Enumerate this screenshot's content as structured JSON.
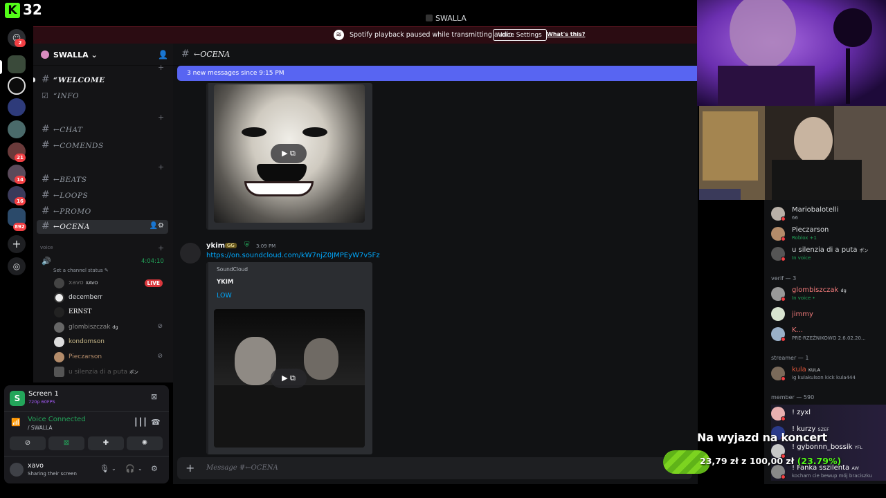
{
  "stream": {
    "viewer_count": "32"
  },
  "window": {
    "title": "SWALLA"
  },
  "notice": {
    "text": "Spotify playback paused while transmitting audio.",
    "button": "Voice Settings",
    "link": "What's this?"
  },
  "rail": {
    "badges": [
      "2",
      "21",
      "14",
      "16",
      "892"
    ]
  },
  "guild": {
    "name": "SWALLA",
    "channels": [
      "“WELCOME",
      "“INFO",
      "←CHAT",
      "←COMENDS",
      "←BEATS",
      "←LOOPS",
      "←PROMO",
      "←OCENA"
    ],
    "voice_category": "voice",
    "voice_timer": "4:04:10",
    "voice_status": "Set a channel status",
    "live_badge": "LIVE",
    "voice_users": [
      {
        "name": "xavo",
        "tag": "XAVO",
        "color": "#6b6b6b"
      },
      {
        "name": "decemberr",
        "tag": "",
        "color": "#dbdee1"
      },
      {
        "name": "ERNST",
        "tag": "",
        "color": "#ffffff"
      },
      {
        "name": "glombiszczak",
        "tag": "dg",
        "color": "#8a8a8a"
      },
      {
        "name": "kondomson",
        "tag": "",
        "color": "#c9b98a"
      },
      {
        "name": "Pieczarson",
        "tag": "",
        "color": "#b48c6a"
      },
      {
        "name": "u silenzia di a puta",
        "tag": "ポン",
        "color": "#5a5a5a"
      }
    ]
  },
  "panel": {
    "screen_title": "Screen 1",
    "screen_sub": "720p 60FPS",
    "vc_title": "Voice Connected",
    "vc_sub": "/ SWALLA",
    "user_name": "xavo",
    "user_status": "Sharing their screen"
  },
  "chat": {
    "channel": "←OCENA",
    "new_messages": "3 new messages since 9:15 PM",
    "author": "ykim",
    "author_badge": "GG",
    "time": "3:09 PM",
    "link": "https://on.soundcloud.com/kW7njZ0JMPEyW7v5Fz",
    "embed_provider": "SoundCloud",
    "embed_author": "YKIM",
    "embed_title": "LOW",
    "composer_placeholder": "Message #←OCENA"
  },
  "members": {
    "top": [
      {
        "name": "Mariobalotelli",
        "sub": "66",
        "color": "#dbdee1"
      },
      {
        "name": "Pieczarson",
        "sub": "Roblox +1",
        "color": "#dbdee1"
      },
      {
        "name": "u silenzia di a puta",
        "sub": "In voice",
        "tag": "ポン",
        "color": "#dbdee1"
      }
    ],
    "verif_header": "verif — 3",
    "verif": [
      {
        "name": "glombiszczak",
        "sub": "In voice •",
        "tag": "dg",
        "color": "#f47b7b"
      },
      {
        "name": "jimmy",
        "sub": "",
        "color": "#f47b7b"
      },
      {
        "name": "K...",
        "sub": "PRE-RZEŹNIKOWO 2.6.02.20...",
        "color": "#f47b7b"
      }
    ],
    "streamer_header": "streamer — 1",
    "streamer": [
      {
        "name": "kula",
        "tag": "KULA",
        "sub": "ig kulakulson kick kula444",
        "color": "#e0563a"
      }
    ],
    "member_header": "member — 590",
    "member": [
      {
        "name": "! zyxl",
        "sub": "",
        "color": "#ffffff"
      },
      {
        "name": "! kurzy",
        "tag": "SZEF",
        "sub": "",
        "color": "#ffffff"
      },
      {
        "name": "! gybonnn_bossik",
        "tag": "YFL",
        "sub": "",
        "color": "#ffffff"
      },
      {
        "name": "! Fanka sszilenta",
        "tag": "AW",
        "sub": "kocham cie bewup mój braciszku",
        "color": "#ffffff"
      }
    ]
  },
  "donation": {
    "title": "Na wyjazd na koncert",
    "current": "23,79 zł",
    "sep": "z",
    "target": "100,00 zł",
    "percent": "(23.79%)",
    "progress": 0.2379
  }
}
